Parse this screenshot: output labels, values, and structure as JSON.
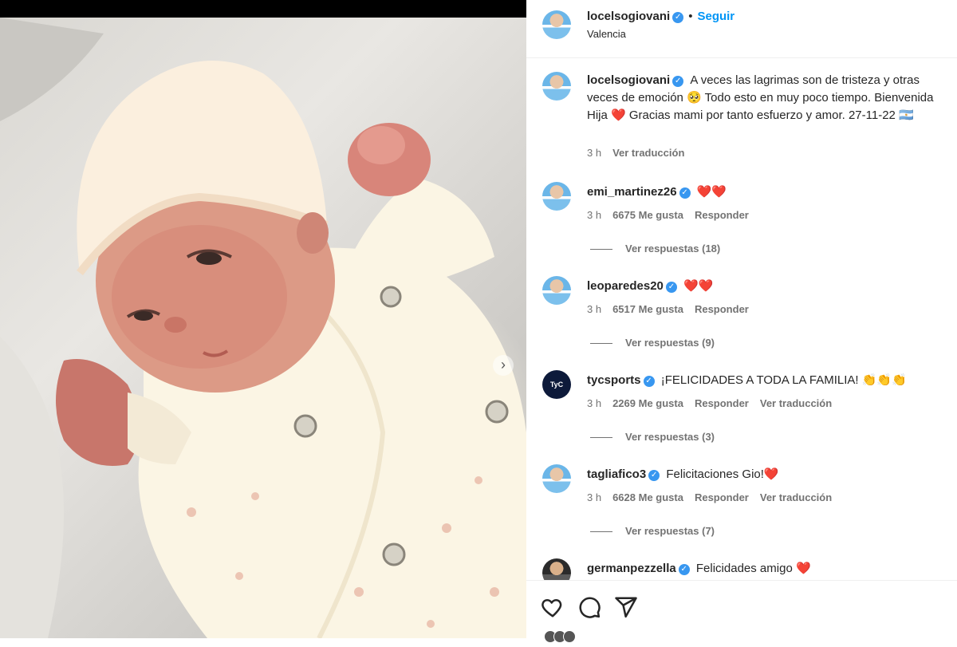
{
  "post": {
    "username": "locelsogiovani",
    "follow_label": "Seguir",
    "location": "Valencia",
    "carousel_next": "›"
  },
  "caption": {
    "username": "locelsogiovani",
    "text_1": "A veces las lagrimas son de tristeza y otras veces de emoción 🥺 Todo esto en muy poco tiempo. Bienvenida Hija ❤️ Gracias mami por tanto esfuerzo y amor. 27-11-22 🇦🇷",
    "time": "3 h",
    "translate": "Ver traducción"
  },
  "comments": [
    {
      "username": "emi_martinez26",
      "text": "❤️❤️",
      "time": "3 h",
      "likes": "6675 Me gusta",
      "reply": "Responder",
      "translate": "",
      "view_replies": "Ver respuestas (18)"
    },
    {
      "username": "leoparedes20",
      "text": "❤️❤️",
      "time": "3 h",
      "likes": "6517 Me gusta",
      "reply": "Responder",
      "translate": "",
      "view_replies": "Ver respuestas (9)"
    },
    {
      "username": "tycsports",
      "text": "¡FELICIDADES A TODA LA FAMILIA! 👏👏👏",
      "time": "3 h",
      "likes": "2269 Me gusta",
      "reply": "Responder",
      "translate": "Ver traducción",
      "view_replies": "Ver respuestas (3)"
    },
    {
      "username": "tagliafico3",
      "text": "Felicitaciones Gio!❤️",
      "time": "3 h",
      "likes": "6628 Me gusta",
      "reply": "Responder",
      "translate": "Ver traducción",
      "view_replies": "Ver respuestas (7)"
    },
    {
      "username": "germanpezzella",
      "text": "Felicidades amigo ❤️"
    }
  ],
  "tyc_avatar_text": "TyC Sports",
  "colors": {
    "accent": "#0095f6",
    "verified": "#3897f0",
    "muted": "#737373"
  },
  "icons": {
    "like": "heart-icon",
    "comment": "comment-icon",
    "share": "share-icon"
  }
}
